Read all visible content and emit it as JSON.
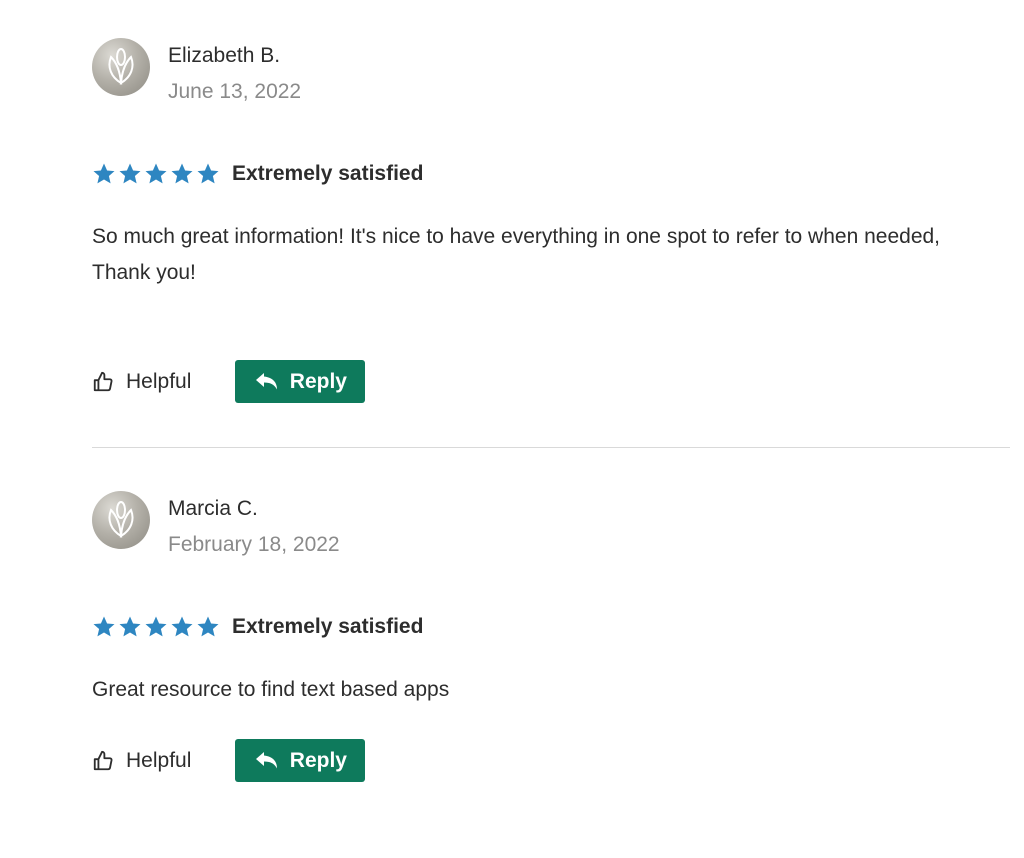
{
  "reviews": [
    {
      "author": "Elizabeth B.",
      "date": "June 13, 2022",
      "rating": 5,
      "rating_label": "Extremely satisfied",
      "body": "So much great information! It's nice to have everything in one spot to refer to when needed, Thank you!",
      "helpful_label": "Helpful",
      "reply_label": "Reply"
    },
    {
      "author": "Marcia C.",
      "date": "February 18, 2022",
      "rating": 5,
      "rating_label": "Extremely satisfied",
      "body": "Great resource to find text based apps",
      "helpful_label": "Helpful",
      "reply_label": "Reply"
    }
  ],
  "colors": {
    "star": "#2e86c1",
    "reply_button": "#0e7a5c",
    "date_text": "#8a8a8a",
    "divider": "#d9d9d9"
  },
  "icons": {
    "avatar": "leaf-logo-icon",
    "star": "star-icon",
    "helpful": "thumbs-up-icon",
    "reply": "reply-arrow-icon"
  }
}
